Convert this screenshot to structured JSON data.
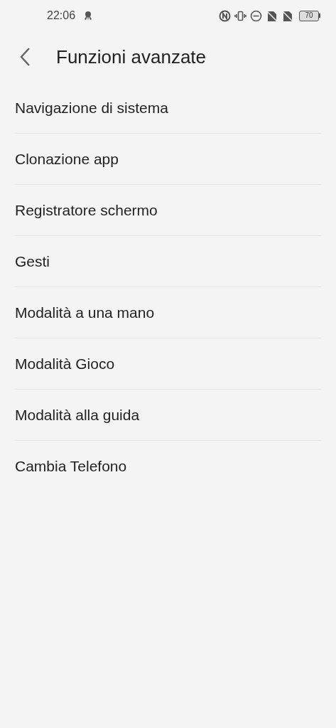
{
  "status_bar": {
    "time": "22:06",
    "battery": "70"
  },
  "header": {
    "title": "Funzioni avanzate"
  },
  "items": [
    {
      "label": "Navigazione di sistema"
    },
    {
      "label": "Clonazione app"
    },
    {
      "label": "Registratore schermo"
    },
    {
      "label": "Gesti"
    },
    {
      "label": "Modalità a una mano"
    },
    {
      "label": "Modalità Gioco"
    },
    {
      "label": "Modalità alla guida"
    },
    {
      "label": "Cambia Telefono"
    }
  ]
}
